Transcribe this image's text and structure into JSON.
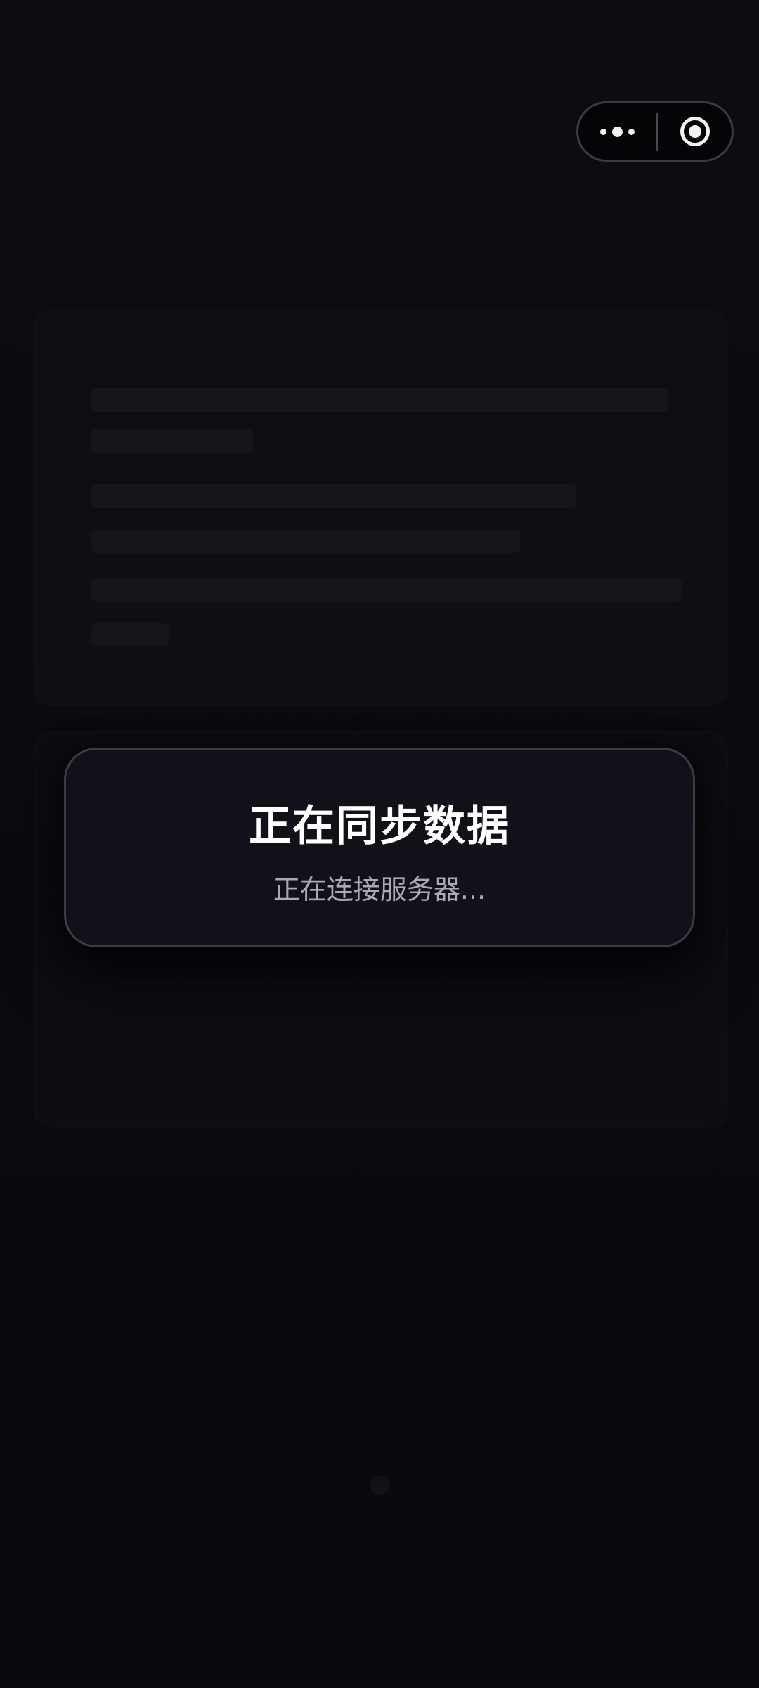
{
  "capsule": {
    "more_icon": "more-dots-icon",
    "close_icon": "target-circle-icon"
  },
  "dialog": {
    "title": "正在同步数据",
    "message": "正在连接服务器..."
  },
  "colors": {
    "background": "#0b0b10",
    "dialog_background": "#11111a",
    "dialog_border": "#3b3c44",
    "dialog_title": "#ffffff",
    "dialog_message": "#a9aab2"
  }
}
